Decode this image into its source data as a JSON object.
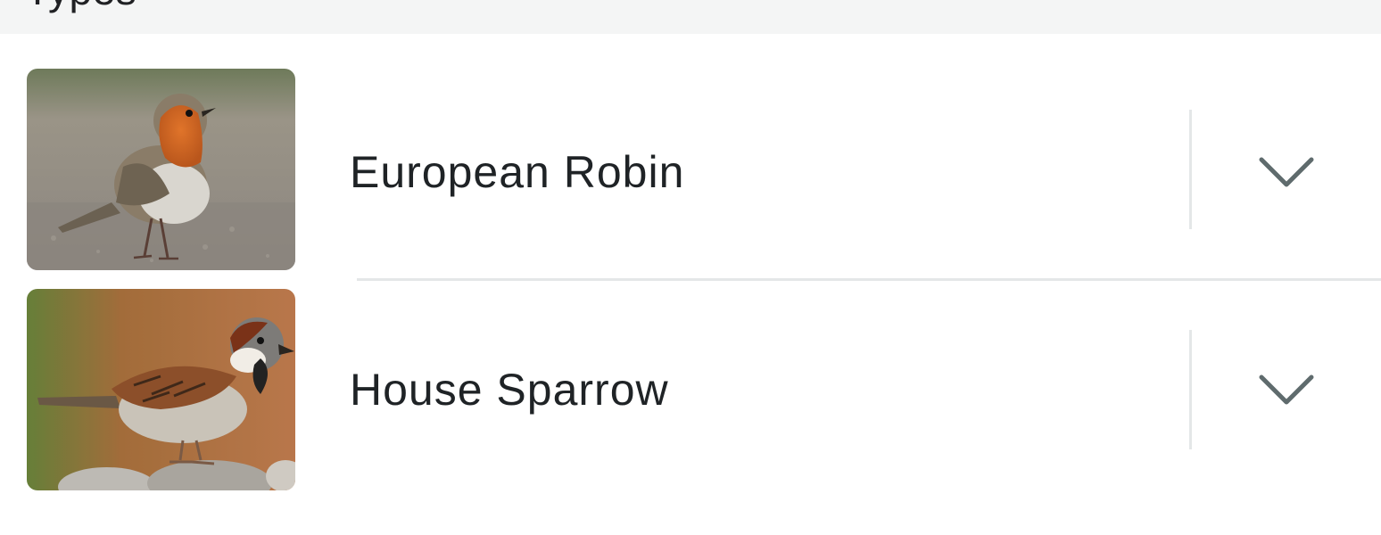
{
  "header": {
    "title": "Types"
  },
  "birds": [
    {
      "name": "European Robin",
      "expand_icon": "chevron-down-icon",
      "photo": "european-robin-photo"
    },
    {
      "name": "House Sparrow",
      "expand_icon": "chevron-down-icon",
      "photo": "house-sparrow-photo"
    }
  ],
  "colors": {
    "text": "#1f2326",
    "divider": "#e4e7e8",
    "chevron": "#5f6b6d",
    "header_bg": "#f4f5f5"
  }
}
